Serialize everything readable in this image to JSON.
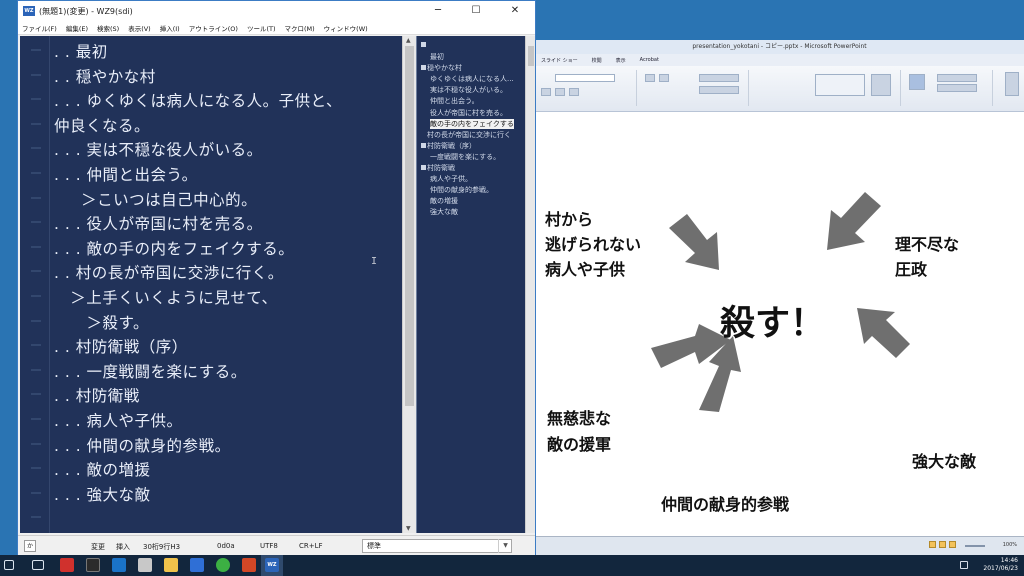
{
  "editor_window": {
    "title": "(無題1)(変更) - WZ9(sdi)",
    "menu": [
      "ファイル(F)",
      "編集(E)",
      "検索(S)",
      "表示(V)",
      "挿入(I)",
      "アウトライン(O)",
      "ツール(T)",
      "マクロ(M)",
      "ウィンドウ(W)"
    ],
    "lines": [
      ". . 最初",
      ". . 穏やかな村",
      ". . . ゆくゆくは病人になる人。子供と、",
      "仲良くなる。",
      ". . . 実は不穏な役人がいる。",
      ". . . 仲間と出会う。",
      "     ＞こいつは自己中心的。",
      ". . . 役人が帝国に村を売る。",
      ". . . 敵の手の内をフェイクする。",
      ". . 村の長が帝国に交渉に行く。",
      "   ＞上手くいくように見せて、",
      "      ＞殺す。",
      ". . 村防衛戦（序）",
      ". . . 一度戦闘を楽にする。",
      ". . 村防衛戦",
      ". . . 病人や子供。",
      ". . . 仲間の献身的参戦。",
      ". . . 敵の増援",
      ". . . 強大な敵"
    ],
    "outline": [
      {
        "text": "最初",
        "indent": 1,
        "box": false,
        "sel": false
      },
      {
        "text": "穏やかな村",
        "indent": 0,
        "box": true,
        "sel": false
      },
      {
        "text": "ゆくゆくは病人になる人...",
        "indent": 1,
        "box": false,
        "sel": false
      },
      {
        "text": "実は不穏な役人がいる。",
        "indent": 1,
        "box": false,
        "sel": false
      },
      {
        "text": "仲間と出会う。",
        "indent": 1,
        "box": false,
        "sel": false
      },
      {
        "text": "役人が帝国に村を売る。",
        "indent": 1,
        "box": false,
        "sel": false
      },
      {
        "text": "敵の手の内をフェイクする",
        "indent": 1,
        "box": false,
        "sel": true
      },
      {
        "text": "村の長が帝国に交渉に行く",
        "indent": 0,
        "box": false,
        "sel": false
      },
      {
        "text": "村防衛戦（序）",
        "indent": 0,
        "box": true,
        "sel": false
      },
      {
        "text": "一度戦闘を楽にする。",
        "indent": 1,
        "box": false,
        "sel": false
      },
      {
        "text": "村防衛戦",
        "indent": 0,
        "box": true,
        "sel": false
      },
      {
        "text": "病人や子供。",
        "indent": 1,
        "box": false,
        "sel": false
      },
      {
        "text": "仲間の献身的参戦。",
        "indent": 1,
        "box": false,
        "sel": false
      },
      {
        "text": "敵の増援",
        "indent": 1,
        "box": false,
        "sel": false
      },
      {
        "text": "強大な敵",
        "indent": 1,
        "box": false,
        "sel": false
      }
    ],
    "status": {
      "ime": "か",
      "mode": "変更",
      "insert": "挿入",
      "position": "30桁9行H3",
      "char_code": "0d0a",
      "encoding": "UTF8",
      "newline": "CR+LF",
      "style": "標準"
    }
  },
  "ppt_window": {
    "title": "presentation_yokotani - コピー.pptx - Microsoft PowerPoint",
    "tabs": [
      "スライド ショー",
      "校閲",
      "表示",
      "Acrobat"
    ],
    "zoom": "100%",
    "slide": {
      "center": "殺す！",
      "labels": [
        {
          "key": "a",
          "text": "村から\n逃げられない\n病人や子供"
        },
        {
          "key": "b",
          "text": "理不尽な\n圧政"
        },
        {
          "key": "c",
          "text": "無慈悲な\n敵の援軍"
        },
        {
          "key": "d",
          "text": "強大な敵"
        },
        {
          "key": "e",
          "text": "仲間の献身的参戦"
        }
      ]
    }
  },
  "taskbar": {
    "clock_time": "14:46",
    "clock_date": "2017/06/23"
  },
  "colors": {
    "editor_bg": "#213259",
    "editor_text": "#e9eef9",
    "arrow_gray": "#6f6f6f",
    "taskbar": "#12263d"
  }
}
